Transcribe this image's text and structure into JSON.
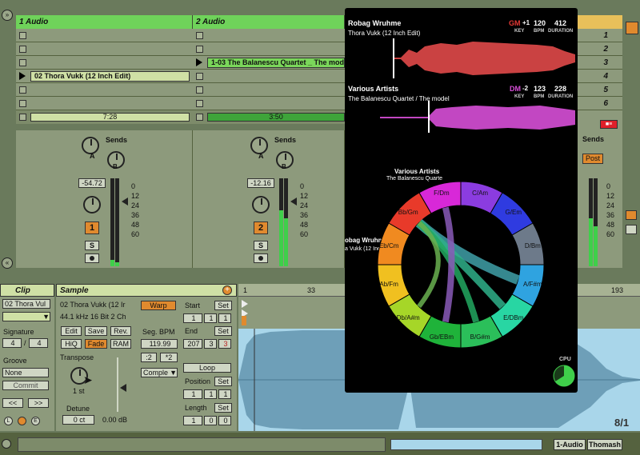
{
  "session": {
    "tracks": [
      {
        "name": "1 Audio",
        "clips": [
          {
            "name": ""
          },
          {
            "name": ""
          },
          {
            "name": ""
          },
          {
            "name": "02 Thora Vukk (12 Inch Edit)",
            "playing": true
          },
          {
            "name": ""
          },
          {
            "name": ""
          }
        ],
        "progress": "7:28",
        "volume": "-54.72",
        "number": "1"
      },
      {
        "name": "2 Audio",
        "clips": [
          {
            "name": ""
          },
          {
            "name": ""
          },
          {
            "name": "1-03 The Balanescu Quartet _ The model",
            "playing": true
          },
          {
            "name": ""
          },
          {
            "name": ""
          },
          {
            "name": ""
          }
        ],
        "progress": "3:50",
        "volume": "-12.16",
        "number": "2"
      }
    ],
    "scenes": [
      "1",
      "2",
      "3",
      "4",
      "5",
      "6"
    ],
    "sends_label": "Sends",
    "knob_a": "A",
    "knob_b": "B",
    "solo_label": "S",
    "scale": [
      "0",
      "12",
      "24",
      "36",
      "48",
      "60"
    ],
    "post_label": "Post",
    "right_scale": [
      "0",
      "12",
      "24",
      "36",
      "48",
      "60"
    ]
  },
  "clip_panel": {
    "header": "Clip",
    "clip_name": "02 Thora Vul",
    "signature_label": "Signature",
    "sig_num": "4",
    "sig_den": "4",
    "groove_label": "Groove",
    "groove_value": "None",
    "commit_label": "Commit",
    "nav_prev": "<<",
    "nav_next": ">>",
    "l_btn": "L",
    "e_btn": "E"
  },
  "sample_panel": {
    "header": "Sample",
    "name": "02 Thora Vukk (12 Ir",
    "info": "44.1 kHz 16 Bit 2 Ch",
    "edit": "Edit",
    "save": "Save",
    "rev": "Rev.",
    "hiq": "HiQ",
    "fade": "Fade",
    "ram": "RAM",
    "transpose_label": "Transpose",
    "transpose_value": "1 st",
    "detune_label": "Detune",
    "detune_value": "0 ct",
    "gain_value": "0.00 dB",
    "warp": "Warp",
    "seg_bpm_label": "Seg. BPM",
    "seg_bpm": "119.99",
    "half": ":2",
    "double": "*2",
    "mode": "Comple",
    "start_label": "Start",
    "end_label": "End",
    "set_label": "Set",
    "start_vals": [
      "1",
      "1",
      "1"
    ],
    "end_vals": [
      "207",
      "3",
      "3"
    ],
    "loop_label": "Loop",
    "position_label": "Position",
    "position_vals": [
      "1",
      "1",
      "1"
    ],
    "length_label": "Length",
    "length_vals": [
      "1",
      "0",
      "0"
    ]
  },
  "waveform": {
    "ruler": [
      "1",
      "33",
      "193"
    ],
    "page": "8/1"
  },
  "overlay": {
    "deck_a": {
      "artist": "Robag Wruhme",
      "title": "Thora Vukk (12 Inch Edit)",
      "key": "GM",
      "key_shift": "+1",
      "bpm": "120",
      "duration": "412",
      "key_color": "#e53935"
    },
    "deck_b": {
      "artist": "Various Artists",
      "title": "The Balanescu Quartet / The model",
      "key": "DM",
      "key_shift": "-2",
      "bpm": "123",
      "duration": "228",
      "key_color": "#d84fd8"
    },
    "labels": {
      "key": "KEY",
      "bpm": "BPM",
      "duration": "DURATION"
    },
    "wheel_top_artist": "Various Artists",
    "wheel_top_title": "The Balanescu Quarte",
    "wheel_left_artist": "obag Wruhme",
    "wheel_left_title": "a Vukk (12 Inc",
    "cpu_label": "CPU",
    "segments": [
      {
        "label": "C/Am",
        "color": "#8b3ce0"
      },
      {
        "label": "G/Em",
        "color": "#2f3be0"
      },
      {
        "label": "D/Bm",
        "color": "#6d7a8a"
      },
      {
        "label": "A/F#m",
        "color": "#2fa3e0"
      },
      {
        "label": "E/DBm",
        "color": "#28d6a3"
      },
      {
        "label": "B/G#m",
        "color": "#2bbf5a"
      },
      {
        "label": "Gb/EBm",
        "color": "#1fb33a"
      },
      {
        "label": "Db/A#m",
        "color": "#a6d628"
      },
      {
        "label": "Ab/Fm",
        "color": "#f0c020"
      },
      {
        "label": "Eb/Cm",
        "color": "#f08a20"
      },
      {
        "label": "Bb/Gm",
        "color": "#e83a2a"
      },
      {
        "label": "F/Dm",
        "color": "#d828d8"
      }
    ]
  },
  "right_strip": {
    "scenes": [
      "",
      "",
      "",
      "",
      "",
      ""
    ]
  },
  "bottom_bar": {
    "track": "1-Audio",
    "user": "Thomash"
  }
}
